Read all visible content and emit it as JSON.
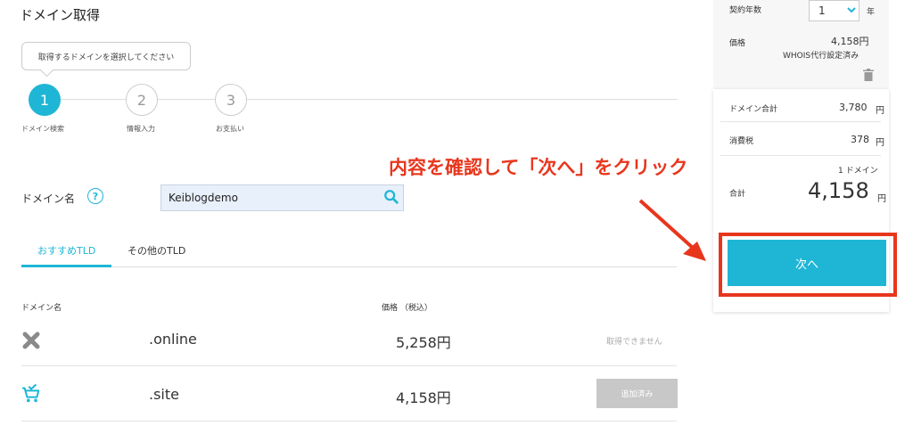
{
  "header": {
    "title": "ドメイン取得"
  },
  "tooltip": {
    "text": "取得するドメインを選択してください"
  },
  "steps": [
    {
      "number": "1",
      "label": "ドメイン検索"
    },
    {
      "number": "2",
      "label": "情報入力"
    },
    {
      "number": "3",
      "label": "お支払い"
    }
  ],
  "search": {
    "label": "ドメイン名",
    "help": "?",
    "value": "Keiblogdemo"
  },
  "tabs": [
    {
      "label": "おすすめTLD"
    },
    {
      "label": "その他のTLD"
    }
  ],
  "table": {
    "headers": {
      "domain": "ドメイン名",
      "price": "価格 （税込）"
    },
    "rows": [
      {
        "tld": ".online",
        "price": "5,258円",
        "status": "取得できません"
      },
      {
        "tld": ".site",
        "price": "4,158円",
        "button": "追加済み"
      }
    ]
  },
  "summary": {
    "years_label": "契約年数",
    "years_value": "1",
    "years_unit": "年",
    "price_label": "価格",
    "price_value": "4,158円",
    "whois_note": "WHOIS代行設定済み",
    "domain_total_label": "ドメイン合計",
    "domain_total_value": "3,780",
    "tax_label": "消費税",
    "tax_value": "378",
    "yen": "円",
    "count": "1 ドメイン",
    "total_label": "合計",
    "total_value": "4,158",
    "next_label": "次へ"
  },
  "annotation": {
    "text": "内容を確認して「次へ」をクリック"
  },
  "colors": {
    "accent": "#1fb6d6",
    "annotation": "#e8361d",
    "disabled": "#c8c8c8"
  }
}
